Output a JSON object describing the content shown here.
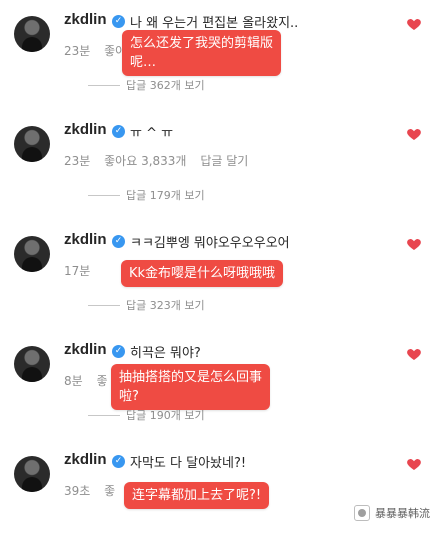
{
  "comments": [
    {
      "username": "zkdlin",
      "text": "나 왜 우는거 편집본 올라왔지..",
      "time": "23분",
      "likes": "좋아요",
      "reply": "",
      "replies_label": "답글 362개 보기",
      "caption": "怎么还发了我哭的剪辑版\n呢…"
    },
    {
      "username": "zkdlin",
      "text": "ㅠ ^ ㅠ",
      "time": "23분",
      "likes": "좋아요 3,833개",
      "reply": "답글 달기",
      "replies_label": "답글 179개 보기",
      "caption": ""
    },
    {
      "username": "zkdlin",
      "text": "ㅋㅋ김뿌엥 뭐야오우오우오어",
      "time": "17분",
      "likes": "",
      "reply": "",
      "replies_label": "답글 323개 보기",
      "caption": "Kk金布嘤是什么呀哦哦哦"
    },
    {
      "username": "zkdlin",
      "text": "히끅은 뭐야?",
      "time": "8분",
      "likes": "좋",
      "reply": "",
      "replies_label": "답글 190개 보기",
      "caption": "抽抽搭搭的又是怎么回事\n啦?"
    },
    {
      "username": "zkdlin",
      "text": "자막도 다 달아놨네?!",
      "time": "39초",
      "likes": "좋",
      "reply": "",
      "replies_label": "",
      "caption": "连字幕都加上去了呢?!"
    }
  ],
  "icons": {
    "verified": "verified-badge-icon",
    "like": "heart-icon",
    "watermark": "wechat-icon"
  },
  "watermark": {
    "text": "暴暴暴韩流"
  },
  "colors": {
    "caption_bg": "#ef4b43",
    "heart": "#e8454f",
    "verified": "#3897f0"
  }
}
